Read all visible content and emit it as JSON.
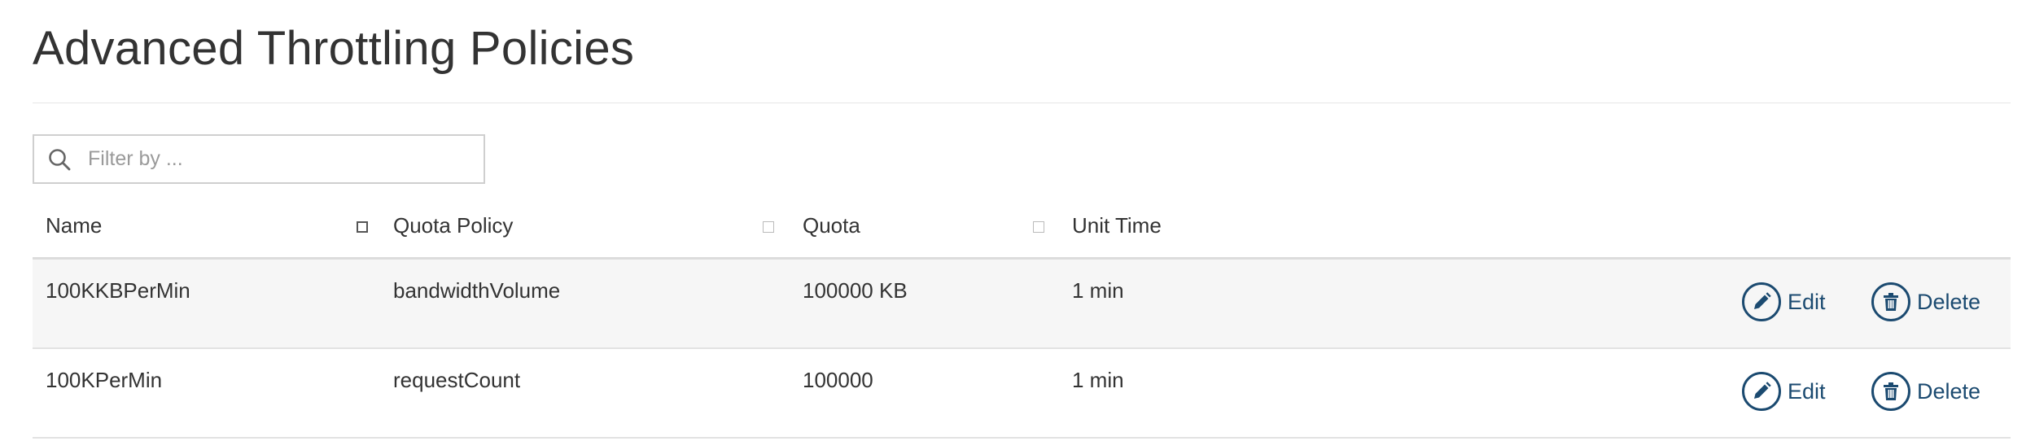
{
  "page": {
    "title": "Advanced Throttling Policies"
  },
  "filter": {
    "placeholder": "Filter by ...",
    "icon": "search-icon"
  },
  "table": {
    "columns": [
      "Name",
      "Quota Policy",
      "Quota",
      "Unit Time"
    ],
    "rows": [
      {
        "name": "100KKBPerMin",
        "quota_policy": "bandwidthVolume",
        "quota": "100000 KB",
        "unit_time": "1 min"
      },
      {
        "name": "100KPerMin",
        "quota_policy": "requestCount",
        "quota": "100000",
        "unit_time": "1 min"
      }
    ],
    "actions": {
      "edit_label": "Edit",
      "delete_label": "Delete"
    }
  },
  "colors": {
    "accent": "#1b4a70",
    "row_alt": "#f6f6f6",
    "border": "#dcdcdc"
  }
}
